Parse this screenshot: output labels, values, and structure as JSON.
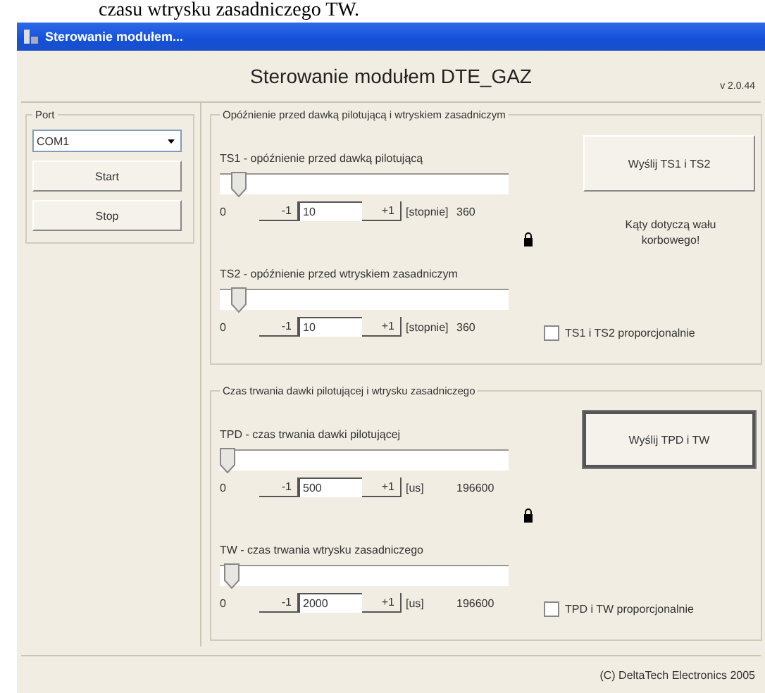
{
  "caption": "czasu wtrysku zasadniczego TW.",
  "window": {
    "title": "Sterowanie modułem..."
  },
  "header": {
    "title": "Sterowanie modułem DTE_GAZ",
    "version": "v 2.0.44"
  },
  "port": {
    "label": "Port",
    "value": "COM1",
    "buttons": [
      "Start",
      "Stop"
    ]
  },
  "groups": [
    {
      "title": "Opóźnienie przed dawką pilotującą i wtryskiem zasadniczym",
      "send_button": "Wyślij TS1 i TS2",
      "note": "Kąty dotyczą wału korbowego!",
      "checkbox": {
        "label": "TS1 i TS2 proporcjonalnie",
        "checked": false
      },
      "default_button": false,
      "sliders": [
        {
          "label": "TS1 - opóźnienie przed dawką pilotującą",
          "min": "0",
          "minus": "-1",
          "value": "10",
          "plus": "+1",
          "unit": "[stopnie]",
          "max": "360",
          "level": 0.03
        },
        {
          "label": "TS2 - opóźnienie przed wtryskiem zasadniczym",
          "min": "0",
          "minus": "-1",
          "value": "10",
          "plus": "+1",
          "unit": "[stopnie]",
          "max": "360",
          "level": 0.03
        }
      ]
    },
    {
      "title": "Czas trwania dawki pilotującej i wtrysku zasadniczego",
      "send_button": "Wyślij TPD i TW",
      "checkbox": {
        "label": "TPD i TW proporcjonalnie",
        "checked": false
      },
      "default_button": true,
      "sliders": [
        {
          "label": "TPD - czas trwania dawki pilotującej",
          "min": "0",
          "minus": "-1",
          "value": "500",
          "plus": "+1",
          "unit": "[us]",
          "max": "196600",
          "level": 0.0
        },
        {
          "label": "TW - czas trwania wtrysku zasadniczego",
          "min": "0",
          "minus": "-1",
          "value": "2000",
          "plus": "+1",
          "unit": "[us]",
          "max": "196600",
          "level": 0.01
        }
      ]
    }
  ],
  "footer": "(C) DeltaTech Electronics 2005"
}
